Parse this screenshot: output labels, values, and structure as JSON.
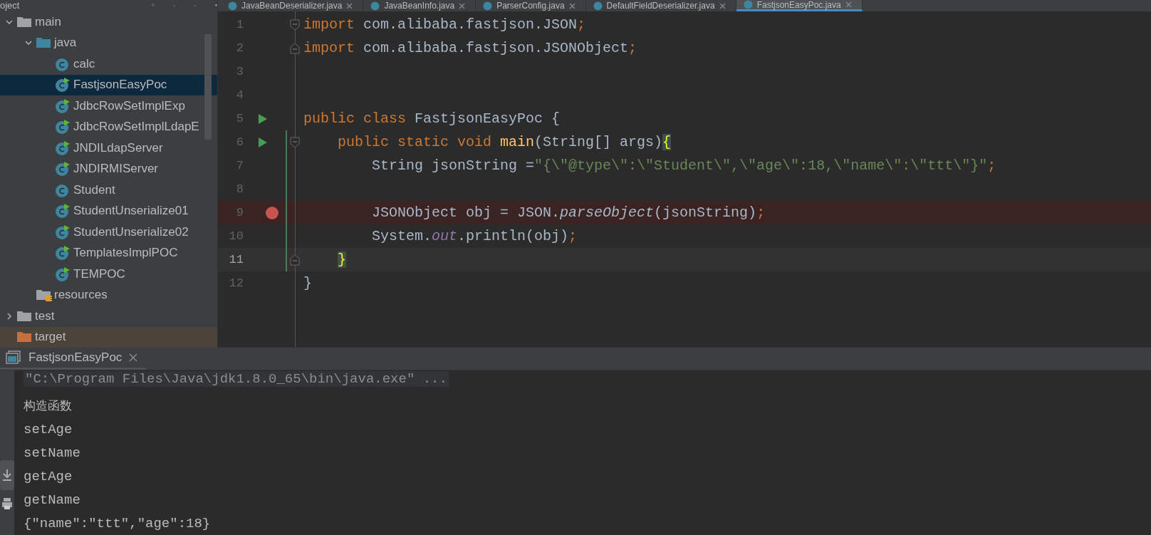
{
  "project_panel": {
    "title": "oject",
    "tree": [
      {
        "label": "main",
        "kind": "folder",
        "expanded": true,
        "selected": false,
        "children": [
          {
            "label": "java",
            "kind": "source-folder",
            "expanded": true,
            "selected": false,
            "children": [
              {
                "label": "calc",
                "kind": "class",
                "selected": false
              },
              {
                "label": "FastjsonEasyPoc",
                "kind": "runnable-class",
                "selected": true
              },
              {
                "label": "JdbcRowSetImplExp",
                "kind": "runnable-class",
                "selected": false
              },
              {
                "label": "JdbcRowSetImplLdapE",
                "kind": "runnable-class",
                "selected": false
              },
              {
                "label": "JNDILdapServer",
                "kind": "runnable-class",
                "selected": false
              },
              {
                "label": "JNDIRMIServer",
                "kind": "runnable-class",
                "selected": false
              },
              {
                "label": "Student",
                "kind": "class",
                "selected": false
              },
              {
                "label": "StudentUnserialize01",
                "kind": "runnable-class",
                "selected": false
              },
              {
                "label": "StudentUnserialize02",
                "kind": "runnable-class",
                "selected": false
              },
              {
                "label": "TemplatesImplPOC",
                "kind": "runnable-class",
                "selected": false
              },
              {
                "label": "TEMPOC",
                "kind": "runnable-class",
                "selected": false
              }
            ]
          },
          {
            "label": "resources",
            "kind": "resource-folder",
            "selected": false
          }
        ]
      },
      {
        "label": "test",
        "kind": "folder",
        "expanded": false,
        "selected": false
      },
      {
        "label": "target",
        "kind": "excluded-folder",
        "selected": false
      }
    ]
  },
  "editor": {
    "tabs": [
      {
        "label": "JavaBeanDeserializer.java",
        "selected": false
      },
      {
        "label": "JavaBeanInfo.java",
        "selected": false
      },
      {
        "label": "ParserConfig.java",
        "selected": false
      },
      {
        "label": "DefaultFieldDeserializer.java",
        "selected": false
      },
      {
        "label": "FastjsonEasyPoc.java",
        "selected": true
      }
    ],
    "lines": [
      {
        "number": "1",
        "run": false,
        "breakpoint": false,
        "fold_start": true,
        "fold_end": false,
        "changed": false,
        "caret": false,
        "tokens": [
          {
            "kind": "keyword",
            "text": "import"
          },
          {
            "kind": "plain",
            "text": " com.alibaba.fastjson.JSON"
          },
          {
            "kind": "punct",
            "text": ";"
          }
        ]
      },
      {
        "number": "2",
        "run": false,
        "breakpoint": false,
        "fold_start": false,
        "fold_end": true,
        "changed": false,
        "caret": false,
        "tokens": [
          {
            "kind": "keyword",
            "text": "import"
          },
          {
            "kind": "plain",
            "text": " com.alibaba.fastjson.JSONObject"
          },
          {
            "kind": "punct",
            "text": ";"
          }
        ]
      },
      {
        "number": "3",
        "run": false,
        "breakpoint": false,
        "fold_start": false,
        "fold_end": false,
        "changed": false,
        "caret": false
      },
      {
        "number": "4",
        "run": false,
        "breakpoint": false,
        "fold_start": false,
        "fold_end": false,
        "changed": false,
        "caret": false
      },
      {
        "number": "5",
        "run": true,
        "breakpoint": false,
        "fold_start": false,
        "fold_end": false,
        "changed": false,
        "caret": false,
        "tokens": [
          {
            "kind": "keyword",
            "text": "public class"
          },
          {
            "kind": "plain",
            "text": " FastjsonEasyPoc {"
          }
        ]
      },
      {
        "number": "6",
        "run": true,
        "breakpoint": false,
        "fold_start": true,
        "fold_end": false,
        "changed": true,
        "caret": false,
        "tokens": [
          {
            "kind": "keyword",
            "text": "    public static void"
          },
          {
            "kind": "method",
            "text": " main"
          },
          {
            "kind": "plain",
            "text": "(String[] args)"
          },
          {
            "kind": "brace",
            "text": "{"
          }
        ]
      },
      {
        "number": "7",
        "run": false,
        "breakpoint": false,
        "fold_start": false,
        "fold_end": false,
        "changed": true,
        "caret": false,
        "tokens": [
          {
            "kind": "plain",
            "text": "        String jsonString ="
          },
          {
            "kind": "string",
            "text": "\"{\\\"@type\\\":\\\"Student\\\",\\\"age\\\":18,\\\"name\\\":\\\"ttt\\\"}\""
          },
          {
            "kind": "punct",
            "text": ";"
          }
        ]
      },
      {
        "number": "8",
        "run": false,
        "breakpoint": false,
        "fold_start": false,
        "fold_end": false,
        "changed": true,
        "caret": false
      },
      {
        "number": "9",
        "run": false,
        "breakpoint": true,
        "fold_start": false,
        "fold_end": false,
        "changed": true,
        "caret": false,
        "tokens": [
          {
            "kind": "plain",
            "text": "        JSONObject obj = JSON."
          },
          {
            "kind": "static-call",
            "text": "parseObject"
          },
          {
            "kind": "plain",
            "text": "(jsonString)"
          },
          {
            "kind": "punct",
            "text": ";"
          }
        ]
      },
      {
        "number": "10",
        "run": false,
        "breakpoint": false,
        "fold_start": false,
        "fold_end": false,
        "changed": true,
        "caret": false,
        "tokens": [
          {
            "kind": "plain",
            "text": "        System."
          },
          {
            "kind": "static-field",
            "text": "out"
          },
          {
            "kind": "plain",
            "text": ".println(obj)"
          },
          {
            "kind": "punct",
            "text": ";"
          }
        ]
      },
      {
        "number": "11",
        "run": false,
        "breakpoint": false,
        "fold_start": false,
        "fold_end": true,
        "changed": true,
        "caret": true,
        "tokens": [
          {
            "kind": "brace",
            "text": "    }"
          }
        ]
      },
      {
        "number": "12",
        "run": false,
        "breakpoint": false,
        "fold_start": false,
        "fold_end": false,
        "changed": false,
        "caret": false,
        "tokens": [
          {
            "kind": "plain",
            "text": "}"
          }
        ]
      }
    ]
  },
  "run_panel": {
    "tab": {
      "label": "FastjsonEasyPoc"
    },
    "output": [
      {
        "kind": "command",
        "text": "\"C:\\Program Files\\Java\\jdk1.8.0_65\\bin\\java.exe\" ..."
      },
      {
        "kind": "output",
        "text": "构造函数"
      },
      {
        "kind": "output",
        "text": "setAge"
      },
      {
        "kind": "output",
        "text": "setName"
      },
      {
        "kind": "output",
        "text": "getAge"
      },
      {
        "kind": "output",
        "text": "getName"
      },
      {
        "kind": "output",
        "text": "{\"name\":\"ttt\",\"age\":18}"
      }
    ]
  }
}
